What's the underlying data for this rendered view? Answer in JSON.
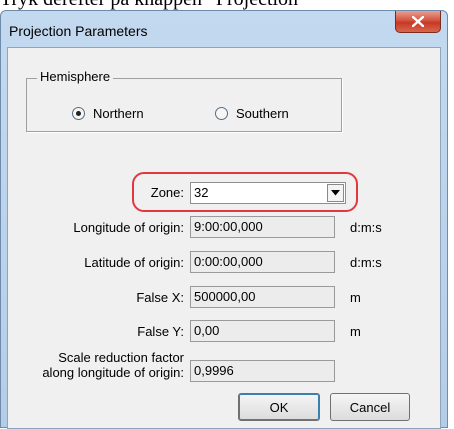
{
  "page_text": "Tryk derefter på knappen “Projection",
  "window": {
    "title": "Projection Parameters"
  },
  "hemisphere": {
    "legend": "Hemisphere",
    "options": [
      {
        "label": "Northern",
        "selected": true
      },
      {
        "label": "Southern",
        "selected": false
      }
    ]
  },
  "zone": {
    "label": "Zone:",
    "value": "32"
  },
  "fields": {
    "longitude": {
      "label": "Longitude of origin:",
      "value": "9:00:00,000",
      "unit": "d:m:s"
    },
    "latitude": {
      "label": "Latitude of origin:",
      "value": "0:00:00,000",
      "unit": "d:m:s"
    },
    "false_x": {
      "label": "False X:",
      "value": "500000,00",
      "unit": "m"
    },
    "false_y": {
      "label": "False Y:",
      "value": "0,00",
      "unit": "m"
    },
    "scale": {
      "label_line1": "Scale reduction factor",
      "label_line2": "along longitude of origin:",
      "value": "0,9996"
    }
  },
  "buttons": {
    "ok": "OK",
    "cancel": "Cancel"
  },
  "colors": {
    "highlight": "#e2373f",
    "close_button": "#c53a24"
  }
}
